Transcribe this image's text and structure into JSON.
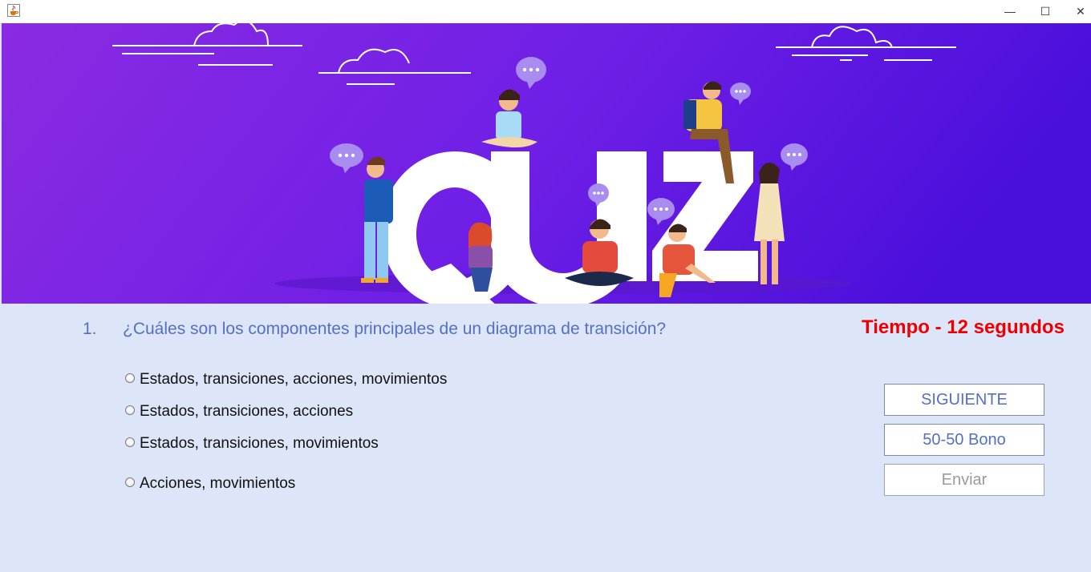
{
  "window": {
    "icon": "java-cup-icon",
    "minimize_glyph": "—",
    "maximize_glyph": "☐",
    "close_glyph": "✕"
  },
  "banner": {
    "word": "QUIZ",
    "gradient_start": "#8a2be2",
    "gradient_end": "#4b0fdc"
  },
  "question": {
    "number": "1.",
    "text": "¿Cuáles son los componentes principales de un diagrama de transición?"
  },
  "timer": {
    "text": "Tiempo - 12 segundos",
    "color": "#ee0000"
  },
  "options": [
    "Estados, transiciones, acciones, movimientos",
    "Estados, transiciones, acciones",
    "Estados, transiciones, movimientos",
    "Acciones, movimientos"
  ],
  "buttons": {
    "next": "SIGUIENTE",
    "bonus": "50-50 Bono",
    "submit": "Enviar"
  },
  "colors": {
    "background": "#dde5f8",
    "accent": "#5470c6"
  }
}
